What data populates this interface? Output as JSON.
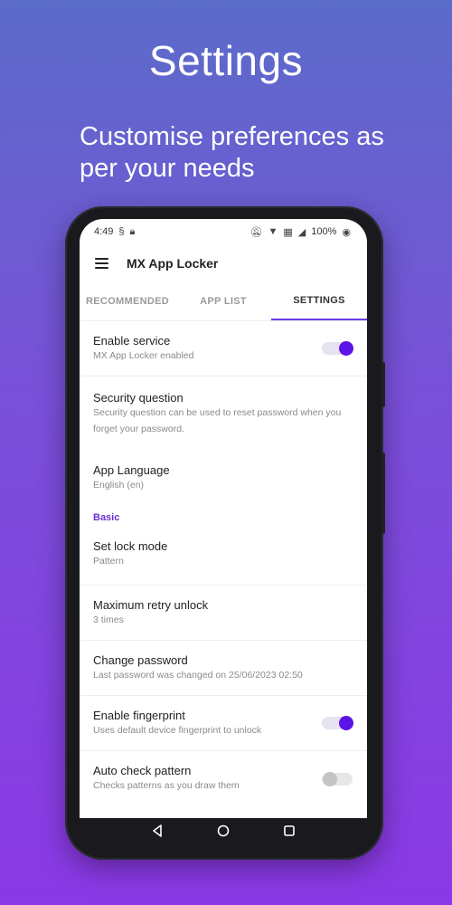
{
  "promo": {
    "title": "Settings",
    "subtitle": "Customise preferences as per your needs"
  },
  "status": {
    "time": "4:49",
    "battery": "100%"
  },
  "app": {
    "title": "MX App Locker"
  },
  "tabs": [
    {
      "label": "RECOMMENDED"
    },
    {
      "label": "APP LIST"
    },
    {
      "label": "SETTINGS"
    }
  ],
  "settings": [
    {
      "title": "Enable service",
      "subtitle": "MX App Locker enabled",
      "toggle": "on"
    },
    {
      "title": "Security question",
      "subtitle": "Security question can be used to reset password when you forget your password."
    },
    {
      "title": "App Language",
      "subtitle": "English (en)"
    }
  ],
  "section_basic": "Basic",
  "basic": [
    {
      "title": "Set lock mode",
      "subtitle": "Pattern"
    },
    {
      "title": "Maximum retry unlock",
      "subtitle": "3 times"
    },
    {
      "title": "Change password",
      "subtitle": "Last password was changed on 25/06/2023 02:50"
    },
    {
      "title": "Enable fingerprint",
      "subtitle": "Uses default device fingerprint to unlock",
      "toggle": "on"
    },
    {
      "title": "Auto check pattern",
      "subtitle": "Checks patterns as you draw them",
      "toggle": "off"
    }
  ],
  "colors": {
    "accent": "#5b14e6",
    "tab_indicator": "#6a3fe6",
    "section": "#6a2fd6"
  },
  "icons": {
    "menu": "hamburger-menu-icon",
    "back": "back-triangle-icon",
    "home": "home-circle-icon",
    "recents": "recents-square-icon"
  }
}
